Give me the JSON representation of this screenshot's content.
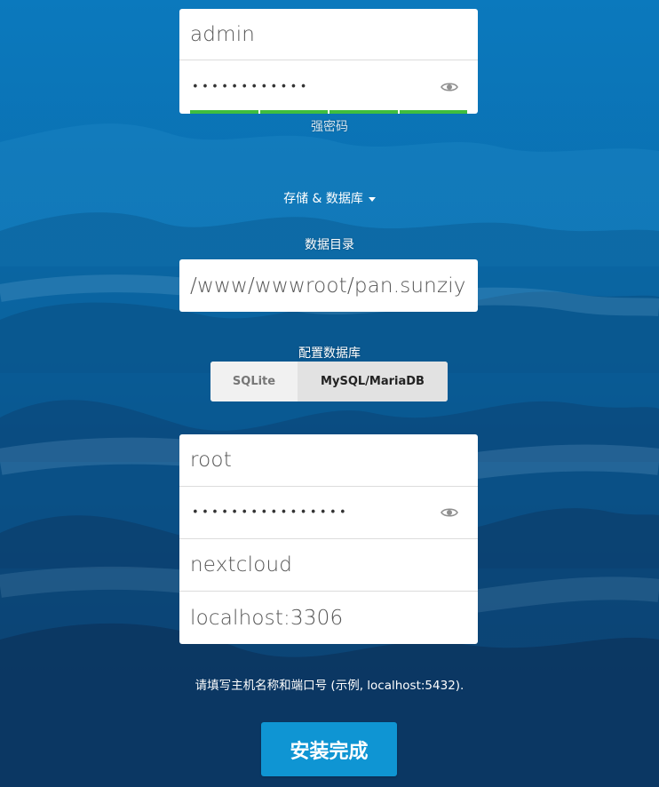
{
  "admin": {
    "username_value": "admin",
    "password_mask": "••••••••••••",
    "strength_label": "强密码"
  },
  "storage": {
    "toggle_label": "存储 & 数据库",
    "data_dir_label": "数据目录",
    "data_dir_value": "/www/wwwroot/pan.sunziya",
    "configure_db_label": "配置数据库",
    "db_options": [
      "SQLite",
      "MySQL/MariaDB"
    ],
    "selected_db": "MySQL/MariaDB"
  },
  "database": {
    "user_value": "root",
    "password_mask": "••••••••••••••••",
    "name_value": "nextcloud",
    "host_value": "localhost:3306",
    "host_hint": "请填写主机名称和端口号 (示例, localhost:5432)."
  },
  "actions": {
    "finish_label": "安装完成"
  },
  "colors": {
    "primary": "#0f95d3",
    "strength": "#3fbd3f"
  },
  "icons": {
    "show_password": "eye-icon",
    "toggle": "caret-down-icon"
  }
}
